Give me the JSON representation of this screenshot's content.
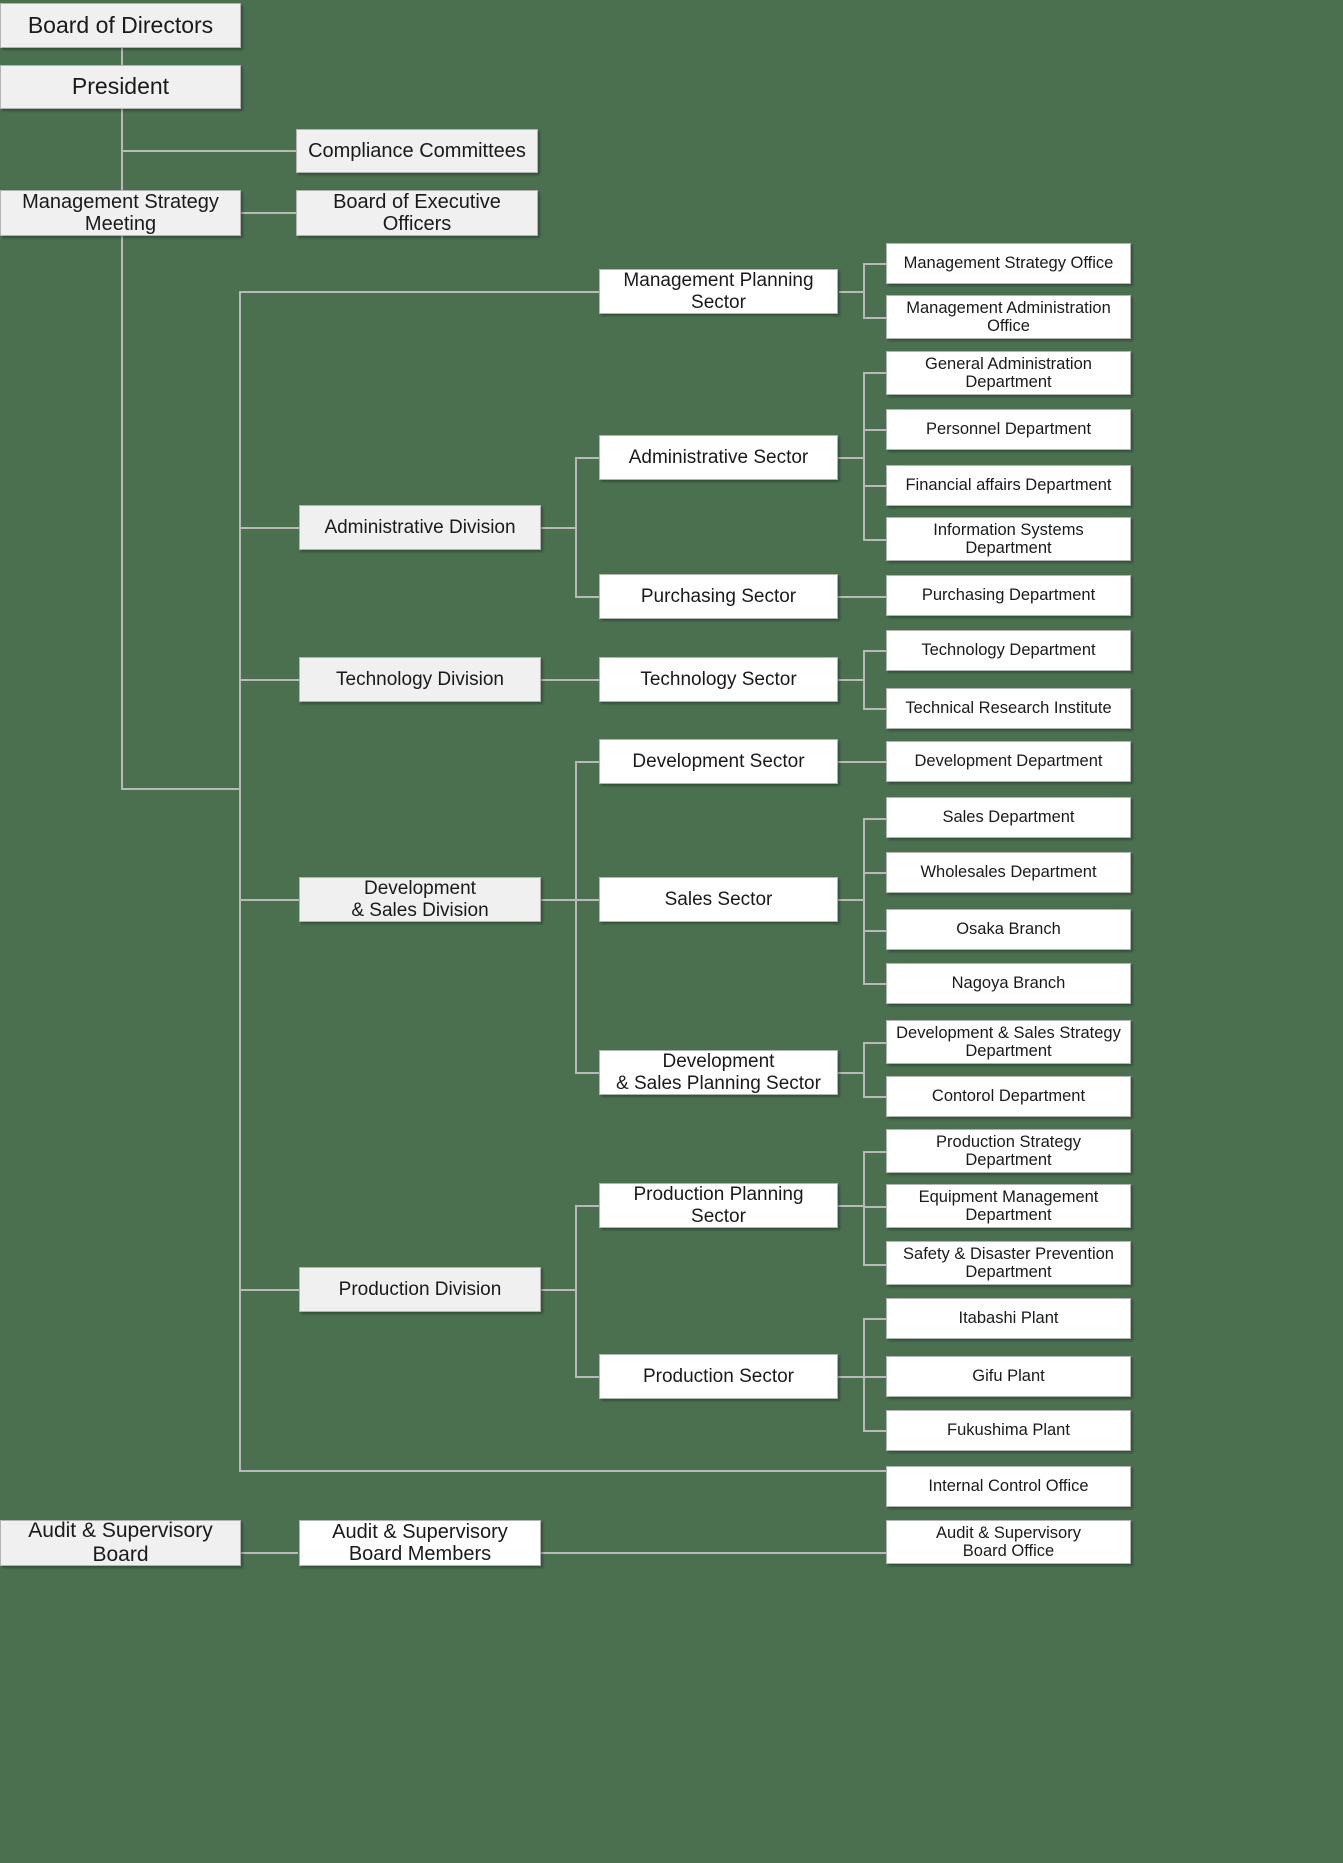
{
  "chart_meta": {
    "type": "org-chart",
    "title": "Corporate Organization Chart",
    "background_color": "#4a7050",
    "box_fill_division": "#f0f0f0",
    "box_fill_sector": "#ffffff",
    "line_color": "#b9b9b9",
    "text_color": "#1a1a1a"
  },
  "governance": {
    "board_of_directors": "Board of Directors",
    "president": "President",
    "management_strategy_meeting": "Management Strategy\nMeeting",
    "compliance_committees": "Compliance Committees",
    "board_of_executive_officers": "Board of Executive\nOfficers"
  },
  "sectors": {
    "management_planning": "Management Planning\nSector",
    "administrative": "Administrative Sector",
    "purchasing": "Purchasing Sector",
    "technology": "Technology Sector",
    "development": "Development Sector",
    "sales": "Sales Sector",
    "development_sales_planning": "Development\n& Sales Planning Sector",
    "production_planning": "Production Planning\nSector",
    "production": "Production Sector"
  },
  "divisions": {
    "administrative": "Administrative Division",
    "technology": "Technology Division",
    "development_sales": "Development\n& Sales Division",
    "production": "Production Division"
  },
  "departments": {
    "management_strategy_office": "Management Strategy Office",
    "management_administration_office": "Management Administration\nOffice",
    "general_administration": "General Administration\nDepartment",
    "personnel": "Personnel Department",
    "financial_affairs": "Financial affairs Department",
    "information_systems": "Information Systems\nDepartment",
    "purchasing": "Purchasing Department",
    "technology": "Technology Department",
    "technical_research_institute": "Technical Research Institute",
    "development": "Development Department",
    "sales": "Sales Department",
    "wholesales": "Wholesales Department",
    "osaka_branch": "Osaka Branch",
    "nagoya_branch": "Nagoya Branch",
    "development_sales_strategy": "Development & Sales Strategy\nDepartment",
    "contorol": "Contorol Department",
    "production_strategy": "Production Strategy\nDepartment",
    "equipment_management": "Equipment Management\nDepartment",
    "safety_disaster_prevention": "Safety & Disaster Prevention\nDepartment",
    "itabashi_plant": "Itabashi Plant",
    "gifu_plant": "Gifu Plant",
    "fukushima_plant": "Fukushima Plant",
    "internal_control_office": "Internal Control Office"
  },
  "audit": {
    "board": "Audit & Supervisory\nBoard",
    "board_members": "Audit & Supervisory\nBoard Members",
    "board_office": "Audit & Supervisory\nBoard Office"
  }
}
